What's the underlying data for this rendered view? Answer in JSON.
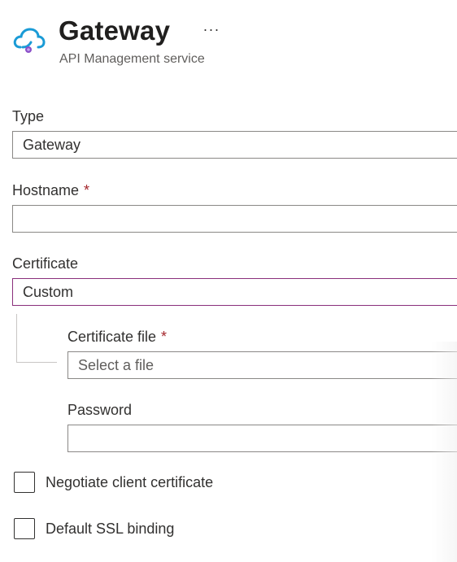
{
  "header": {
    "title": "Gateway",
    "subtitle": "API Management service",
    "more_label": "···",
    "icon": "api-management-cloud-icon",
    "icon_colors": {
      "cloud": "#1a9bd6",
      "dot": "#8a4fc8"
    }
  },
  "form": {
    "type": {
      "label": "Type",
      "value": "Gateway"
    },
    "hostname": {
      "label": "Hostname",
      "required": "*",
      "value": ""
    },
    "certificate": {
      "label": "Certificate",
      "value": "Custom"
    },
    "certificate_file": {
      "label": "Certificate file",
      "required": "*",
      "placeholder": "Select a file"
    },
    "password": {
      "label": "Password",
      "value": ""
    },
    "negotiate_client_certificate": {
      "label": "Negotiate client certificate",
      "checked": false
    },
    "default_ssl_binding": {
      "label": "Default SSL binding",
      "checked": false
    }
  },
  "colors": {
    "required": "#a4262c",
    "focus_border": "#8a2f7c",
    "border": "#8a8886"
  }
}
